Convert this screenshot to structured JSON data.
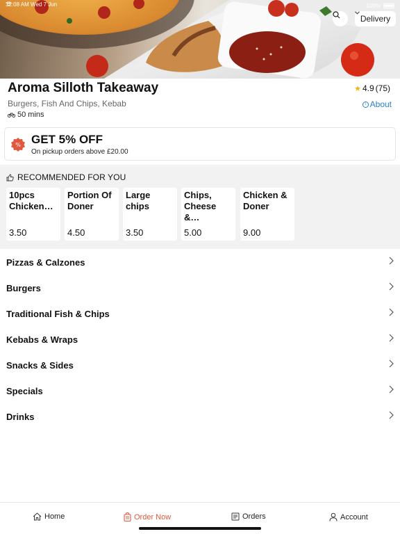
{
  "status_bar": {
    "time": "12:08 AM",
    "day": "Wed 7 Jun",
    "battery": "100%"
  },
  "header": {
    "delivery_label": "Delivery"
  },
  "restaurant": {
    "name": "Aroma Silloth Takeaway",
    "rating": "4.9",
    "rating_count": "(75)",
    "cuisines": "Burgers, Fish And Chips, Kebab",
    "eta": "50 mins",
    "about_label": "About"
  },
  "offer": {
    "badge": "%",
    "title": "GET 5% OFF",
    "subtitle": "On pickup orders above £20.00"
  },
  "recommended": {
    "title": "RECOMMENDED FOR YOU",
    "items": [
      {
        "name_line1": "10pcs",
        "name_line2": "Chicken…",
        "price": "3.50"
      },
      {
        "name_line1": "Portion Of",
        "name_line2": "Doner",
        "price": "4.50"
      },
      {
        "name_line1": "Large chips",
        "name_line2": "",
        "price": "3.50"
      },
      {
        "name_line1": "Chips,",
        "name_line2": "Cheese &…",
        "price": "5.00"
      },
      {
        "name_line1": "Chicken &",
        "name_line2": "Doner",
        "price": "9.00"
      }
    ]
  },
  "categories": [
    "Pizzas & Calzones",
    "Burgers",
    "Traditional Fish & Chips",
    "Kebabs & Wraps",
    "Snacks & Sides",
    "Specials",
    "Drinks"
  ],
  "bottom_nav": {
    "home": "Home",
    "order_now": "Order Now",
    "orders": "Orders",
    "account": "Account"
  },
  "colors": {
    "accent": "#e2583e",
    "link": "#2a7dc9",
    "star": "#f4b400"
  }
}
